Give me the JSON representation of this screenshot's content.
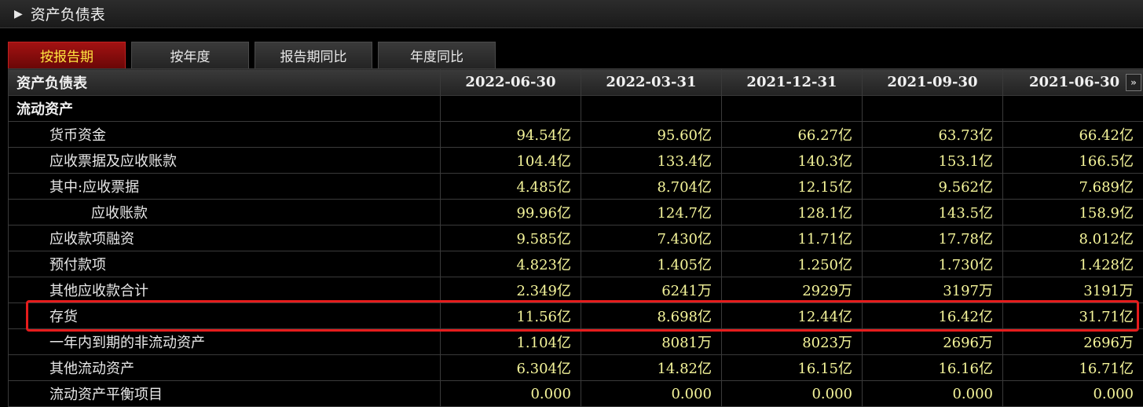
{
  "header": {
    "title": "资产负债表"
  },
  "tabs": [
    {
      "label": "按报告期",
      "active": true
    },
    {
      "label": "按年度",
      "active": false
    },
    {
      "label": "报告期同比",
      "active": false
    },
    {
      "label": "年度同比",
      "active": false
    }
  ],
  "table": {
    "corner_label": "资产负债表",
    "columns": [
      "2022-06-30",
      "2022-03-31",
      "2021-12-31",
      "2021-09-30",
      "2021-06-30"
    ],
    "rows": [
      {
        "label": "流动资产",
        "level": 0,
        "values": [
          "",
          "",
          "",
          "",
          ""
        ]
      },
      {
        "label": "货币资金",
        "level": 1,
        "values": [
          "94.54亿",
          "95.60亿",
          "66.27亿",
          "63.73亿",
          "66.42亿"
        ]
      },
      {
        "label": "应收票据及应收账款",
        "level": 1,
        "values": [
          "104.4亿",
          "133.4亿",
          "140.3亿",
          "153.1亿",
          "166.5亿"
        ]
      },
      {
        "label": "其中:应收票据",
        "level": 1,
        "values": [
          "4.485亿",
          "8.704亿",
          "12.15亿",
          "9.562亿",
          "7.689亿"
        ]
      },
      {
        "label": "应收账款",
        "level": 2,
        "values": [
          "99.96亿",
          "124.7亿",
          "128.1亿",
          "143.5亿",
          "158.9亿"
        ]
      },
      {
        "label": "应收款项融资",
        "level": 1,
        "values": [
          "9.585亿",
          "7.430亿",
          "11.71亿",
          "17.78亿",
          "8.012亿"
        ]
      },
      {
        "label": "预付款项",
        "level": 1,
        "values": [
          "4.823亿",
          "1.405亿",
          "1.250亿",
          "1.730亿",
          "1.428亿"
        ]
      },
      {
        "label": "其他应收款合计",
        "level": 1,
        "values": [
          "2.349亿",
          "6241万",
          "2929万",
          "3197万",
          "3191万"
        ]
      },
      {
        "label": "存货",
        "level": 1,
        "values": [
          "11.56亿",
          "8.698亿",
          "12.44亿",
          "16.42亿",
          "31.71亿"
        ]
      },
      {
        "label": "一年内到期的非流动资产",
        "level": 1,
        "values": [
          "1.104亿",
          "8081万",
          "8023万",
          "2696万",
          "2696万"
        ]
      },
      {
        "label": "其他流动资产",
        "level": 1,
        "values": [
          "6.304亿",
          "14.82亿",
          "16.15亿",
          "16.16亿",
          "16.71亿"
        ]
      },
      {
        "label": "流动资产平衡项目",
        "level": 1,
        "values": [
          "0.000",
          "0.000",
          "0.000",
          "0.000",
          "0.000"
        ]
      }
    ]
  },
  "more_columns_icon": "double-chevron-right-icon",
  "colors": {
    "value_text": "#f5f59a",
    "active_tab_bg": "#8b0d0d",
    "active_tab_text": "#ffe640",
    "highlight_border": "#e51c1c"
  }
}
